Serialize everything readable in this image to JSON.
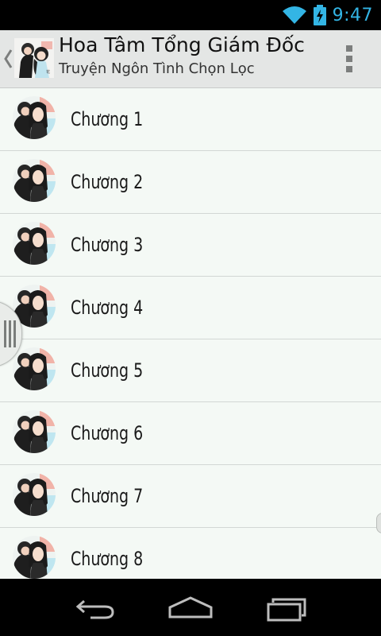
{
  "status_bar": {
    "time": "9:47",
    "accent_color": "#33b5e5"
  },
  "action_bar": {
    "title": "Hoa Tâm Tổng Giám Đốc",
    "subtitle": "Truyện Ngôn Tình Chọn Lọc"
  },
  "chapters": [
    {
      "label": "Chương 1"
    },
    {
      "label": "Chương 2"
    },
    {
      "label": "Chương 3"
    },
    {
      "label": "Chương 4"
    },
    {
      "label": "Chương 5"
    },
    {
      "label": "Chương 6"
    },
    {
      "label": "Chương 7"
    },
    {
      "label": "Chương 8"
    }
  ],
  "icons": {
    "status": [
      "wifi-icon",
      "battery-charging-icon"
    ],
    "nav": [
      "back-icon",
      "home-icon",
      "recents-icon"
    ],
    "action_bar": [
      "up-caret-icon",
      "app-cover-icon",
      "overflow-menu-icon"
    ]
  }
}
